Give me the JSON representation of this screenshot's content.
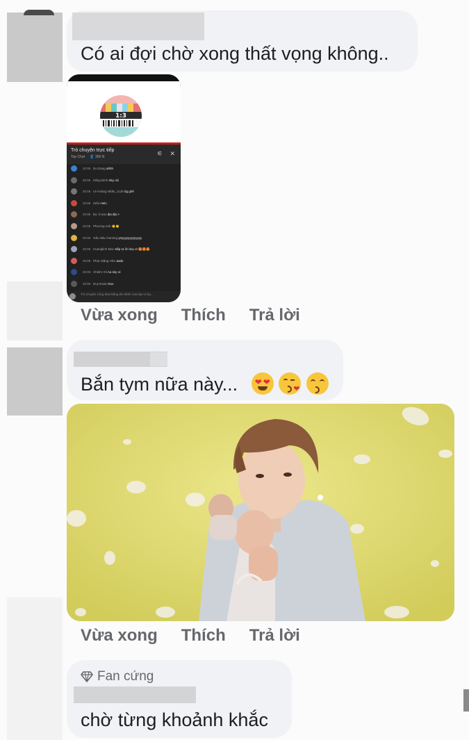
{
  "comments": [
    {
      "text": "Có ai đợi chờ xong thất vọng không..",
      "actions": {
        "time": "Vừa xong",
        "like": "Thích",
        "reply": "Trả lời"
      }
    },
    {
      "text": "Bắn tym nữa này...",
      "emojis": [
        "heart-eyes-emoji",
        "kissing-heart-emoji",
        "kissing-smiling-eyes-emoji"
      ],
      "actions": {
        "time": "Vừa xong",
        "like": "Thích",
        "reply": "Trả lời"
      }
    },
    {
      "badge": "Fan cứng",
      "badge_icon": "diamond-icon",
      "text": "chờ từng khoảnh khắc"
    }
  ],
  "phone_screenshot": {
    "clock": "1:3",
    "chat_title": "Trò chuyện trực tiếp",
    "chat_mode": "Top Chat",
    "viewers": "366 N",
    "messages": [
      {
        "time": "20:05",
        "name": "Do Dang",
        "text": "ahhh",
        "color": "#3b7fd6"
      },
      {
        "time": "20:05",
        "name": "Hằng Bình",
        "text": "Sky ơiii",
        "color": "#6b6b6b"
      },
      {
        "time": "20:05",
        "name": "Lê Hoàng Nhân_1126",
        "text": "ôg ghê",
        "color": "#777777"
      },
      {
        "time": "20:05",
        "name": "Hiếu",
        "text": "Helu",
        "color": "#c74b3c"
      },
      {
        "time": "20:05",
        "name": "kw .li woo",
        "text": "địa địa >",
        "color": "#8c6a52"
      },
      {
        "time": "20:05",
        "name": "Phương Anh",
        "text": "👏👏",
        "color": "#b59a8a"
      },
      {
        "time": "20:05",
        "name": "Gấu Nâu Gaming",
        "text": "yeyyyyyyyyyyyyy",
        "color": "#e0b340"
      },
      {
        "time": "20:05",
        "name": "Hoanglinh Mac",
        "text": "Sắp ra lời sky ơi 😍😍😍",
        "color": "#9aa6b5"
      },
      {
        "time": "20:05",
        "name": "Phúc Đặng Hữu",
        "text": "aade",
        "color": "#d05d5d"
      },
      {
        "time": "20:05",
        "name": "Chiêm Vũ",
        "text": "Aa sky ơi",
        "color": "#2d4a8a"
      },
      {
        "time": "20:05",
        "name": "Duy Đoàn",
        "text": "Noo",
        "color": "#5a5a5a"
      }
    ],
    "footer": "Trò chuyện công khai bằng tên kênh của bạn ví dụ..."
  }
}
